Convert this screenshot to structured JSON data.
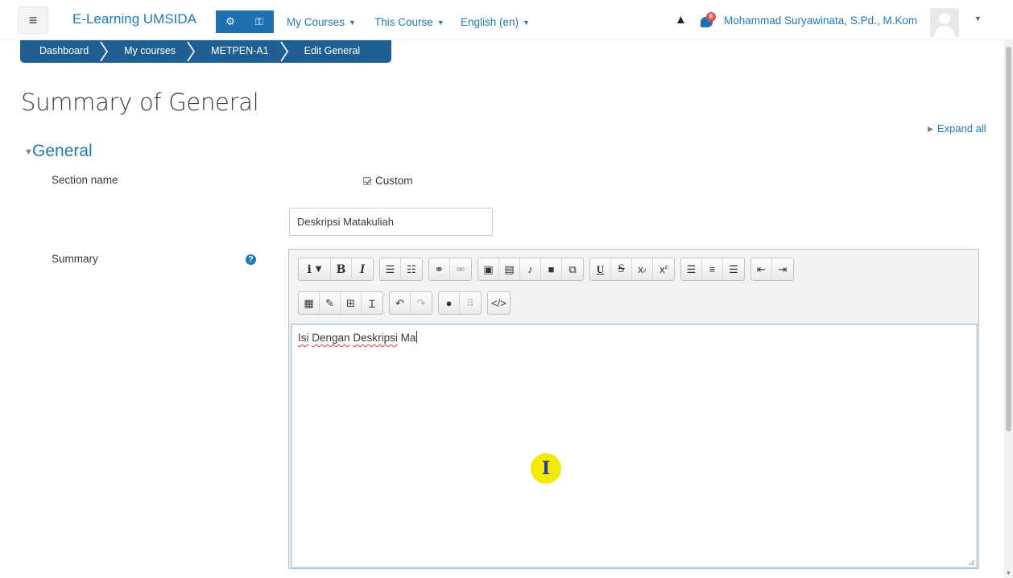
{
  "navbar": {
    "brand": "E-Learning UMSIDA",
    "menu": [
      "My Courses",
      "This Course",
      "English (en)"
    ],
    "notification_count": "6",
    "user_name": "Mohammad Suryawinata, S.Pd., M.Kom"
  },
  "breadcrumb": [
    "Dashboard",
    "My courses",
    "METPEN-A1",
    "Edit General"
  ],
  "page": {
    "title": "Summary of General",
    "expand_all": "Expand all",
    "section_title": "General"
  },
  "form": {
    "section_name_label": "Section name",
    "custom_label": "Custom",
    "section_name_value": "Deskripsi Matakuliah",
    "summary_label": "Summary",
    "summary_text_words": [
      "Isi",
      "Dengan",
      "Deskripsi",
      "Ma"
    ]
  },
  "editor_toolbar": {
    "bold": "B",
    "italic": "I",
    "underline": "U",
    "strike": "S"
  },
  "colors": {
    "brand_blue": "#1f7ab8",
    "breadcrumb_bg": "#1f5f93",
    "nav_button_bg": "#1d71b0",
    "cursor_highlight": "#f4e900"
  }
}
